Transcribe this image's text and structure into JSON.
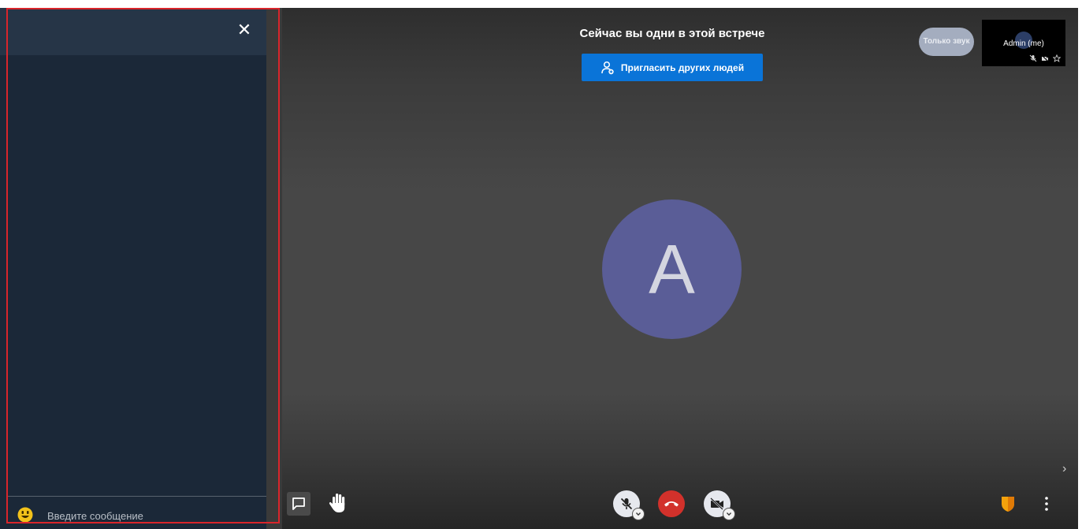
{
  "meeting": {
    "alone_message": "Сейчас вы одни в этой встрече",
    "invite_label": "Пригласить других людей",
    "avatar_initial": "A"
  },
  "thumbnails": {
    "audio_only_label": "Только звук",
    "self_name": "Admin (me)"
  },
  "chat": {
    "input_placeholder": "Введите сообщение",
    "close_symbol": "✕"
  },
  "icons": {
    "close": "close-icon",
    "emoji": "smiley-face-icon",
    "invite": "add-person-icon",
    "chat_toggle": "chat-bubble-icon",
    "raise_hand": "raise-hand-icon",
    "mic": "microphone-muted-icon",
    "hangup": "phone-hangup-icon",
    "camera": "camera-off-icon",
    "security": "shield-icon",
    "more": "more-vertical-icon",
    "chevron": "chevron-right-icon"
  },
  "colors": {
    "accent": "#0a74d8",
    "hangup": "#d2312b",
    "avatar": "#5a5d97",
    "chat_panel": "#1b2838",
    "highlight_frame": "#d9252b",
    "security": "#f4a20c"
  }
}
